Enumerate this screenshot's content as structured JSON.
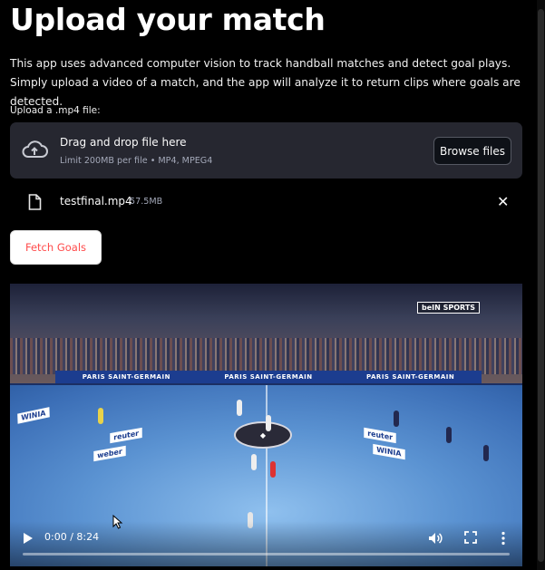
{
  "page": {
    "title": "Upload your match",
    "description": "This app uses advanced computer vision to track handball matches and detect goal plays. Simply upload a video of a match, and the app will analyze it to return clips where goals are detected."
  },
  "uploader": {
    "label": "Upload a .mp4 file:",
    "drop_title": "Drag and drop file here",
    "drop_subtitle": "Limit 200MB per file • MP4, MPEG4",
    "browse_label": "Browse files",
    "icon": "cloud-upload-icon"
  },
  "uploaded_file": {
    "name": "testfinal.mp4",
    "size": "57.5MB",
    "icon": "file-icon",
    "remove_icon": "close-icon"
  },
  "actions": {
    "fetch_label": "Fetch Goals"
  },
  "video": {
    "time": "0:00 / 8:24",
    "progress": 0.0,
    "broadcaster": "beIN SPORTS",
    "banner_texts": [
      "PARIS SAINT-GERMAIN",
      "PARIS SAINT-GERMAIN",
      "PARIS SAINT-GERMAIN"
    ],
    "court_signs": [
      "WINIA",
      "reuter",
      "weber",
      "WINIA",
      "reuter"
    ]
  },
  "colors": {
    "background": "#000000",
    "panel": "#262730",
    "accent": "#ff4b4b",
    "muted_text": "#a3a8b8"
  }
}
